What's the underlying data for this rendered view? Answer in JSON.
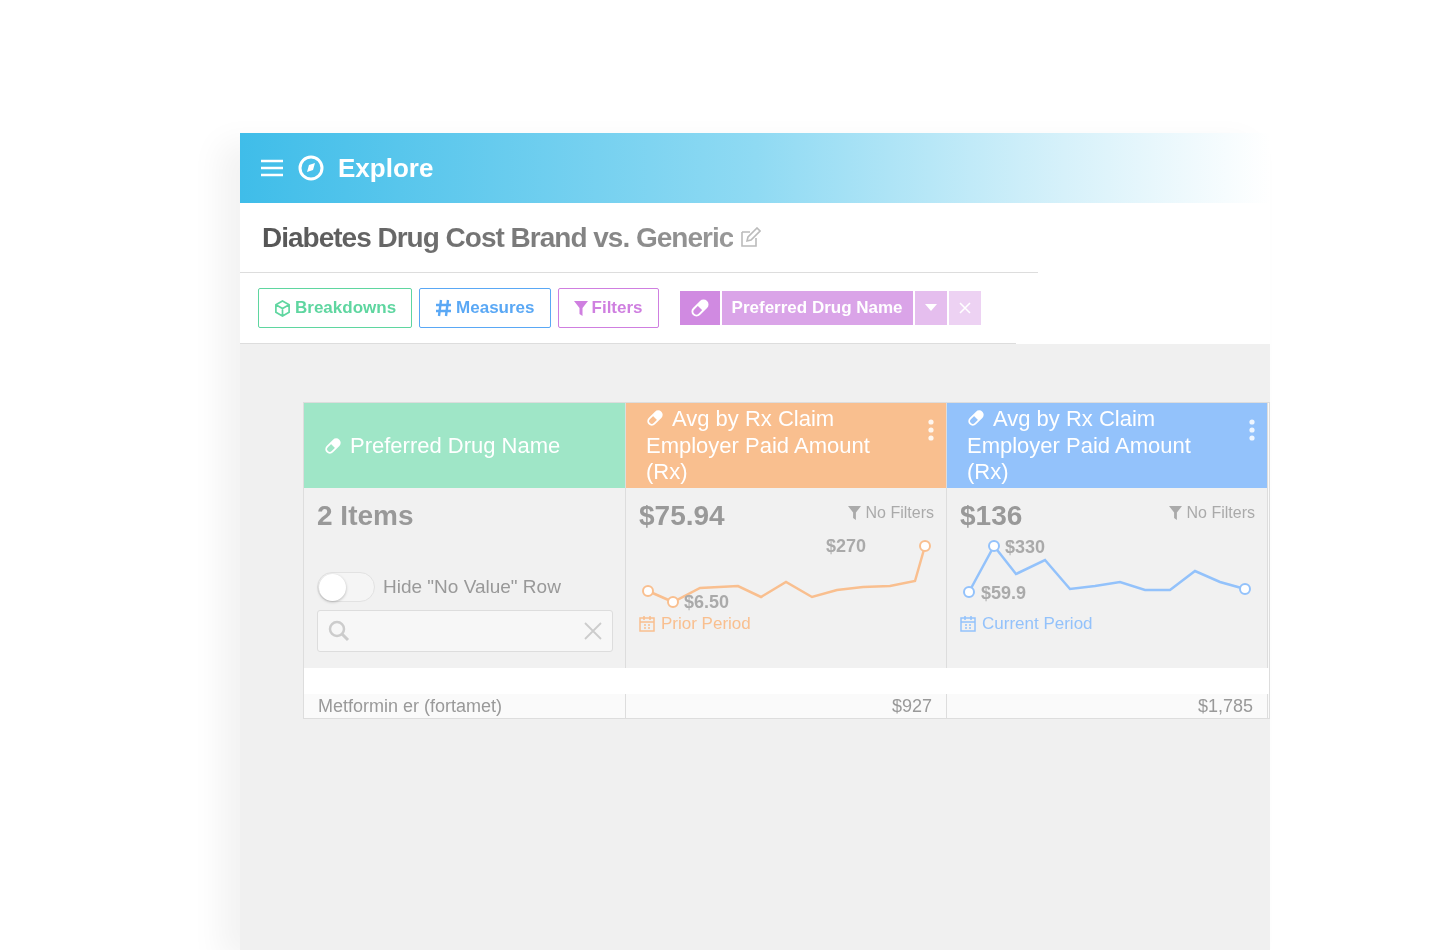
{
  "header": {
    "title": "Explore"
  },
  "report": {
    "title": "Diabetes Drug Cost Brand vs. Generic"
  },
  "toolbar": {
    "buttons": [
      {
        "kind": "breakdowns",
        "label": "Breakdowns"
      },
      {
        "kind": "measures",
        "label": "Measures"
      },
      {
        "kind": "filters",
        "label": "Filters"
      }
    ],
    "chip": {
      "label": "Preferred Drug Name"
    }
  },
  "table": {
    "dimension": {
      "title": "Preferred Drug Name",
      "count": "2 Items",
      "toggle": {
        "label": "Hide \"No Value\" Row",
        "on": false
      }
    },
    "measures": [
      {
        "kind": "prior",
        "title": "Avg by Rx Claim Employer Paid Amount (Rx)",
        "value": "$75.94",
        "filter_label": "No Filters",
        "max_label": "$270",
        "min_label": "$6.50",
        "period": "Prior Period",
        "color": "#f9bf8f"
      },
      {
        "kind": "current",
        "title": "Avg by Rx Claim Employer Paid Amount (Rx)",
        "value": "$136",
        "filter_label": "No Filters",
        "max_label": "$330",
        "min_label": "$59.9",
        "period": "Current Period",
        "color": "#93c2fb"
      }
    ],
    "rows": [
      {
        "cells": [
          "Metformin er (fortamet)",
          "$927",
          "$1,785"
        ]
      }
    ]
  }
}
